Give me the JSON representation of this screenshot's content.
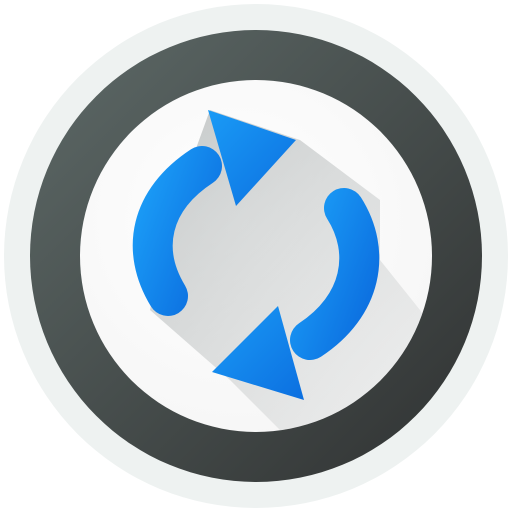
{
  "icon": {
    "name": "refresh-sync-icon",
    "colors": {
      "halo": "#eef2f1",
      "ring_light": "#5e6a68",
      "ring_dark": "#2f3131",
      "face": "#f6f6f6",
      "arrow_light": "#1a9bf6",
      "arrow_dark": "#0c6fe0",
      "shadow": "#9aa0a0"
    }
  }
}
